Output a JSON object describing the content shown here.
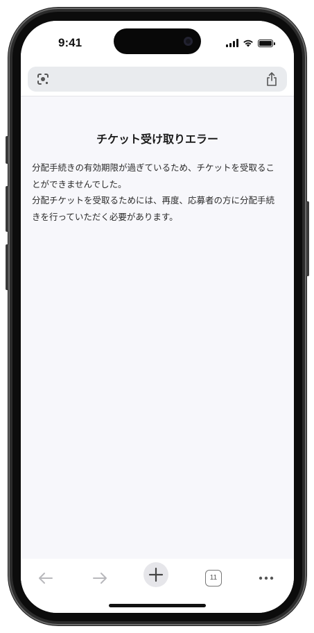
{
  "status_bar": {
    "time": "9:41"
  },
  "url_bar": {
    "left_icon": "google-lens-icon",
    "right_icon": "share-icon"
  },
  "page": {
    "title": "チケット受け取りエラー",
    "paragraphs": [
      "分配手続きの有効期限が過ぎているため、チケットを受取ることができませんでした。",
      "分配チケットを受取るためには、再度、応募者の方に分配手続きを行っていただく必要があります。"
    ]
  },
  "bottom_toolbar": {
    "back_icon": "arrow-left-icon",
    "forward_icon": "arrow-right-icon",
    "new_tab_icon": "plus-icon",
    "tab_count": "11",
    "more_icon": "more-horizontal-icon"
  },
  "colors": {
    "content_background": "#f7f7fb",
    "url_bar_background": "#e9ebee",
    "disabled_icon": "#b8b8bc",
    "text": "#2a2a2a"
  }
}
